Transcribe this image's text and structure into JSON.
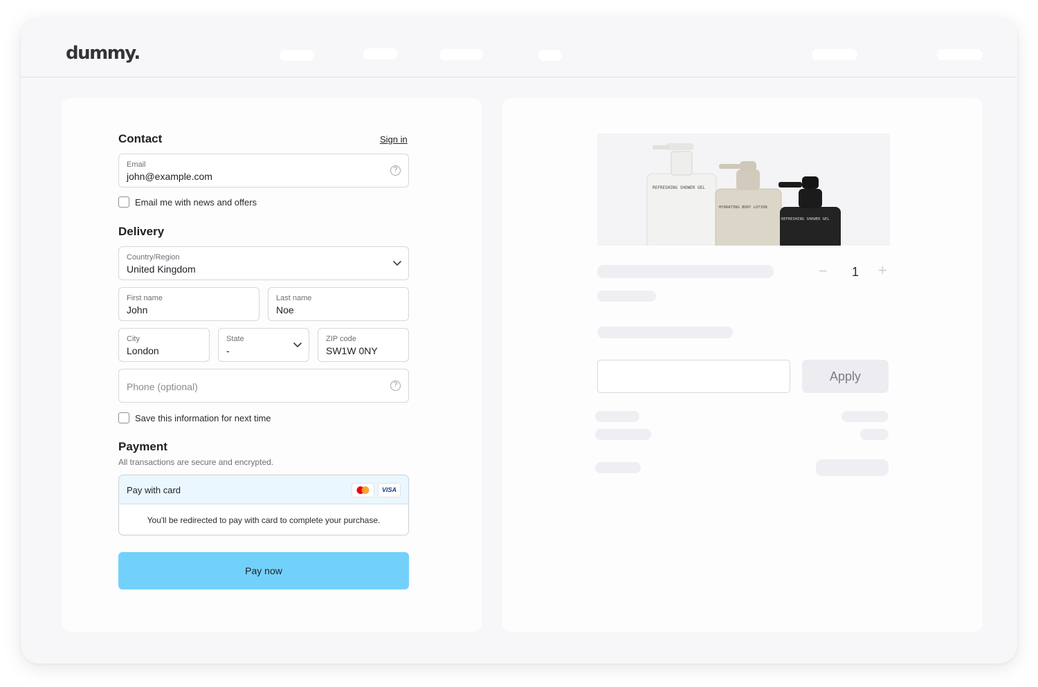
{
  "brand": {
    "logo": "dummy."
  },
  "contact": {
    "title": "Contact",
    "sign_in": "Sign in",
    "email_label": "Email",
    "email_value": "john@example.com",
    "newsletter_label": "Email me with news and offers",
    "newsletter_checked": false
  },
  "delivery": {
    "title": "Delivery",
    "country_label": "Country/Region",
    "country_value": "United Kingdom",
    "first_name_label": "First name",
    "first_name_value": "John",
    "last_name_label": "Last name",
    "last_name_value": "Noe",
    "city_label": "City",
    "city_value": "London",
    "state_label": "State",
    "state_value": "-",
    "zip_label": "ZIP code",
    "zip_value": "SW1W 0NY",
    "phone_placeholder": "Phone (optional)",
    "save_info_label": "Save this information for next time",
    "save_info_checked": false
  },
  "payment": {
    "title": "Payment",
    "subtitle": "All transactions are secure and encrypted.",
    "method_label": "Pay with card",
    "card_brands": [
      "mastercard-icon",
      "visa-icon"
    ],
    "visa_text": "VISA",
    "redirect_note": "You'll be redirected to pay with card to complete your purchase.",
    "pay_button": "Pay now"
  },
  "order": {
    "quantity": "1",
    "minus": "−",
    "plus": "+",
    "apply_button": "Apply",
    "product_labels": [
      "REFRESHING SHOWER GEL",
      "HYDRATING BODY LOTION",
      "REFRESHING SHOWER GEL"
    ]
  },
  "colors": {
    "accent": "#72d1fb",
    "pay_header_bg": "#eaf7ff",
    "page_bg": "#f7f7f9"
  }
}
